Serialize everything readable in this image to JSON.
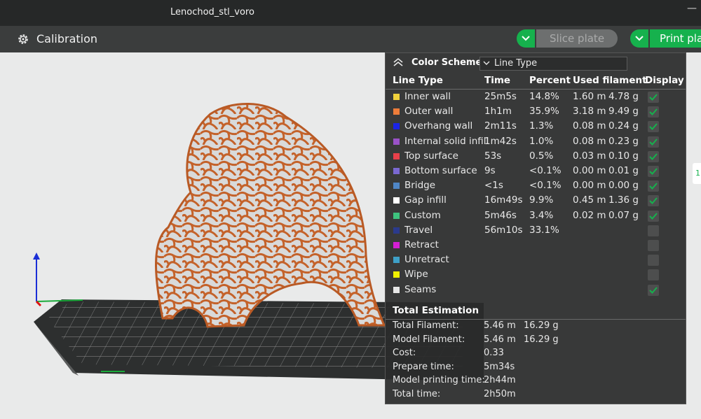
{
  "window": {
    "title": "Lenochod_stl_voro",
    "minimize_glyph": "—"
  },
  "toolbar": {
    "calibration_label": "Calibration",
    "calibration_icon": "gear-icon",
    "slice_label": "Slice plate",
    "print_label": "Print pla"
  },
  "side_tab": {
    "text": "1"
  },
  "panel": {
    "scheme_label": "Color Scheme",
    "scheme_value": "Line Type",
    "headers": {
      "type": "Line Type",
      "time": "Time",
      "percent": "Percent",
      "used": "Used filament",
      "display": "Display"
    },
    "rows": [
      {
        "name": "Inner wall",
        "color": "#f0d23c",
        "time": "25m5s",
        "percent": "14.8%",
        "len": "1.60 m",
        "weight": "4.78 g",
        "checked": true
      },
      {
        "name": "Outer wall",
        "color": "#ee7d3a",
        "time": "1h1m",
        "percent": "35.9%",
        "len": "3.18 m",
        "weight": "9.49 g",
        "checked": true
      },
      {
        "name": "Overhang wall",
        "color": "#1a24e6",
        "time": "2m11s",
        "percent": "1.3%",
        "len": "0.08 m",
        "weight": "0.24 g",
        "checked": true
      },
      {
        "name": "Internal solid infill",
        "color": "#9a52c8",
        "time": "1m42s",
        "percent": "1.0%",
        "len": "0.08 m",
        "weight": "0.23 g",
        "checked": true
      },
      {
        "name": "Top surface",
        "color": "#e8404a",
        "time": "53s",
        "percent": "0.5%",
        "len": "0.03 m",
        "weight": "0.10 g",
        "checked": true
      },
      {
        "name": "Bottom surface",
        "color": "#7a68d2",
        "time": "9s",
        "percent": "<0.1%",
        "len": "0.00 m",
        "weight": "0.01 g",
        "checked": true
      },
      {
        "name": "Bridge",
        "color": "#4f86c6",
        "time": "<1s",
        "percent": "<0.1%",
        "len": "0.00 m",
        "weight": "0.00 g",
        "checked": true
      },
      {
        "name": "Gap infill",
        "color": "#ffffff",
        "time": "16m49s",
        "percent": "9.9%",
        "len": "0.45 m",
        "weight": "1.36 g",
        "checked": true
      },
      {
        "name": "Custom",
        "color": "#3ec27e",
        "time": "5m46s",
        "percent": "3.4%",
        "len": "0.02 m",
        "weight": "0.07 g",
        "checked": true
      },
      {
        "name": "Travel",
        "color": "#2b3a8c",
        "time": "56m10s",
        "percent": "33.1%",
        "len": "",
        "weight": "",
        "checked": false
      },
      {
        "name": "Retract",
        "color": "#d41ed4",
        "time": "",
        "percent": "",
        "len": "",
        "weight": "",
        "checked": false
      },
      {
        "name": "Unretract",
        "color": "#3ea0c8",
        "time": "",
        "percent": "",
        "len": "",
        "weight": "",
        "checked": false
      },
      {
        "name": "Wipe",
        "color": "#f0f000",
        "time": "",
        "percent": "",
        "len": "",
        "weight": "",
        "checked": false
      },
      {
        "name": "Seams",
        "color": "#e6e6e6",
        "time": "",
        "percent": "",
        "len": "",
        "weight": "",
        "checked": true
      }
    ],
    "total_title": "Total Estimation",
    "totals": [
      {
        "label": "Total Filament:",
        "v1": "5.46 m",
        "v2": "16.29 g"
      },
      {
        "label": "Model Filament:",
        "v1": "5.46 m",
        "v2": "16.29 g"
      },
      {
        "label": "Cost:",
        "v1": "0.33",
        "v2": ""
      },
      {
        "label": "Prepare time:",
        "v1": "5m34s",
        "v2": ""
      },
      {
        "label": "Model printing time:",
        "v1": "2h44m",
        "v2": ""
      },
      {
        "label": "Total time:",
        "v1": "2h50m",
        "v2": ""
      }
    ]
  }
}
